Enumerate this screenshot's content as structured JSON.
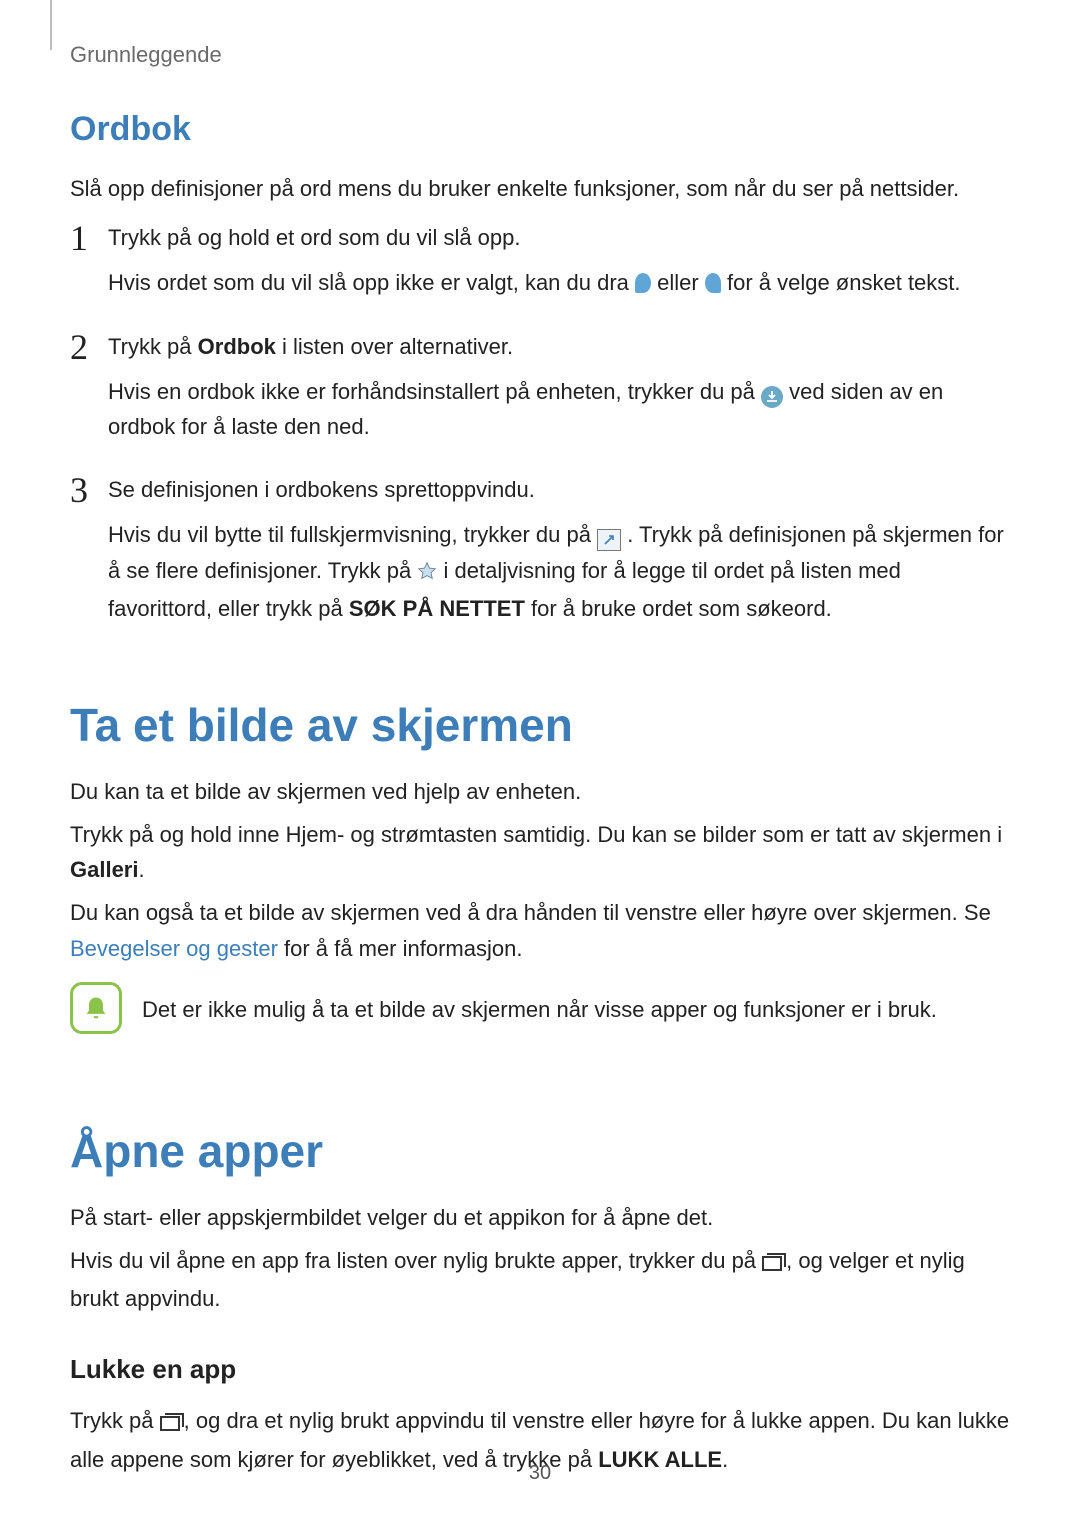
{
  "breadcrumb": "Grunnleggende",
  "ordbok": {
    "heading": "Ordbok",
    "intro": "Slå opp definisjoner på ord mens du bruker enkelte funksjoner, som når du ser på nettsider.",
    "step1a": "Trykk på og hold et ord som du vil slå opp.",
    "step1b_pre": "Hvis ordet som du vil slå opp ikke er valgt, kan du dra ",
    "step1b_mid": " eller ",
    "step1b_post": " for å velge ønsket tekst.",
    "step2a_pre": "Trykk på ",
    "step2a_bold": "Ordbok",
    "step2a_post": " i listen over alternativer.",
    "step2b_pre": "Hvis en ordbok ikke er forhåndsinstallert på enheten, trykker du på ",
    "step2b_post": " ved siden av en ordbok for å laste den ned.",
    "step3a": "Se definisjonen i ordbokens sprettoppvindu.",
    "step3b_pre": "Hvis du vil bytte til fullskjermvisning, trykker du på ",
    "step3b_mid1": ". Trykk på definisjonen på skjermen for å se flere definisjoner. Trykk på ",
    "step3b_mid2": " i detaljvisning for å legge til ordet på listen med favorittord, eller trykk på ",
    "step3b_bold": "SØK PÅ NETTET",
    "step3b_post": " for å bruke ordet som søkeord."
  },
  "screenshot": {
    "heading": "Ta et bilde av skjermen",
    "p1": "Du kan ta et bilde av skjermen ved hjelp av enheten.",
    "p2_pre": "Trykk på og hold inne Hjem- og strømtasten samtidig. Du kan se bilder som er tatt av skjermen i ",
    "p2_bold": "Galleri",
    "p2_post": ".",
    "p3_pre": "Du kan også ta et bilde av skjermen ved å dra hånden til venstre eller høyre over skjermen. Se ",
    "p3_link": "Bevegelser og gester",
    "p3_post": " for å få mer informasjon.",
    "note": "Det er ikke mulig å ta et bilde av skjermen når visse apper og funksjoner er i bruk."
  },
  "openapps": {
    "heading": "Åpne apper",
    "p1": "På start- eller appskjermbildet velger du et appikon for å åpne det.",
    "p2_pre": "Hvis du vil åpne en app fra listen over nylig brukte apper, trykker du på ",
    "p2_post": ", og velger et nylig brukt appvindu.",
    "h3": "Lukke en app",
    "p3_pre": "Trykk på ",
    "p3_mid": ", og dra et nylig brukt appvindu til venstre eller høyre for å lukke appen. Du kan lukke alle appene som kjører for øyeblikket, ved å trykke på ",
    "p3_bold": "LUKK ALLE",
    "p3_post": "."
  },
  "page_number": "30",
  "nums": {
    "n1": "1",
    "n2": "2",
    "n3": "3"
  }
}
